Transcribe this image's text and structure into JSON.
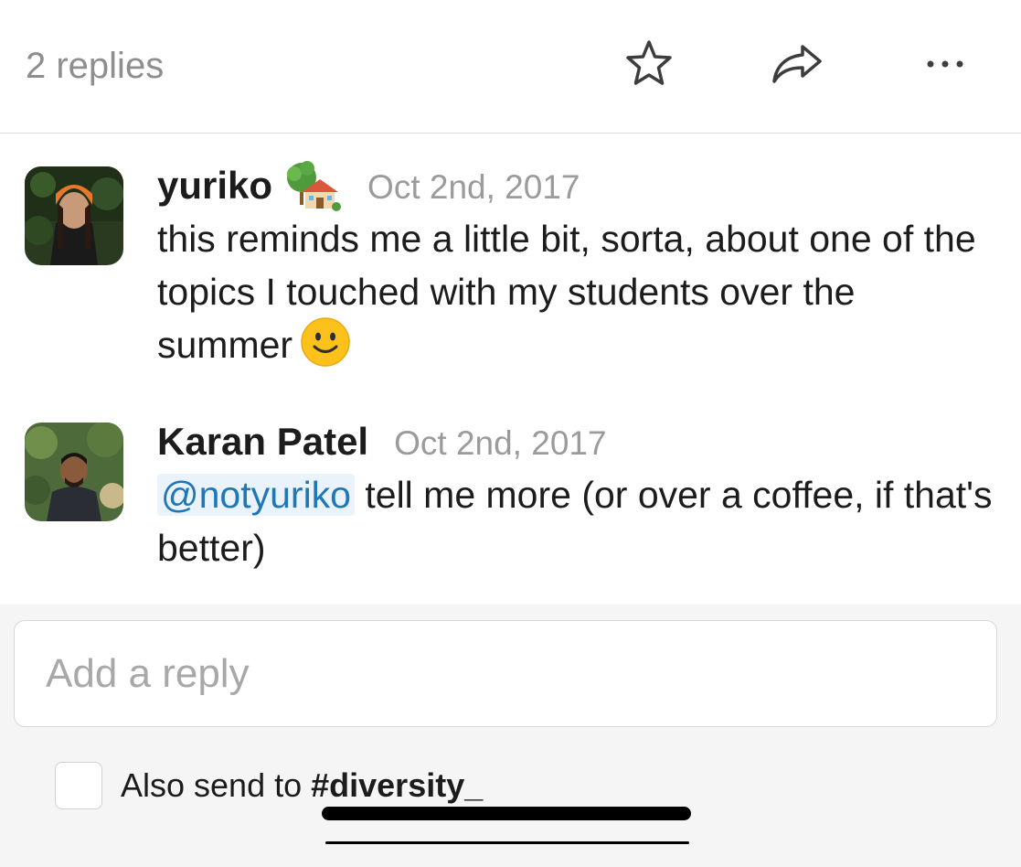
{
  "header": {
    "replies_label": "2 replies",
    "icons": [
      "star-icon",
      "share-icon",
      "more-icon"
    ]
  },
  "messages": [
    {
      "author": "yuriko",
      "status_emoji": "house-with-garden",
      "timestamp": "Oct 2nd, 2017",
      "text": "this reminds me a little bit, sorta, about one of the topics I touched with my students over the summer",
      "trailing_emoji": "slightly-smiling-face"
    },
    {
      "author": "Karan Patel",
      "timestamp": "Oct 2nd, 2017",
      "mention": "@notyuriko",
      "text": " tell me more (or over a coffee, if that's better)"
    }
  ],
  "composer": {
    "placeholder": "Add a reply",
    "value": "",
    "also_send_label": "Also send to",
    "channel": "#diversity_",
    "checkbox_checked": false
  },
  "colors": {
    "mention_text": "#1f77b8",
    "mention_bg": "#eaf3fb",
    "muted_text": "#9b9b9b",
    "footer_bg": "#f5f5f5"
  }
}
